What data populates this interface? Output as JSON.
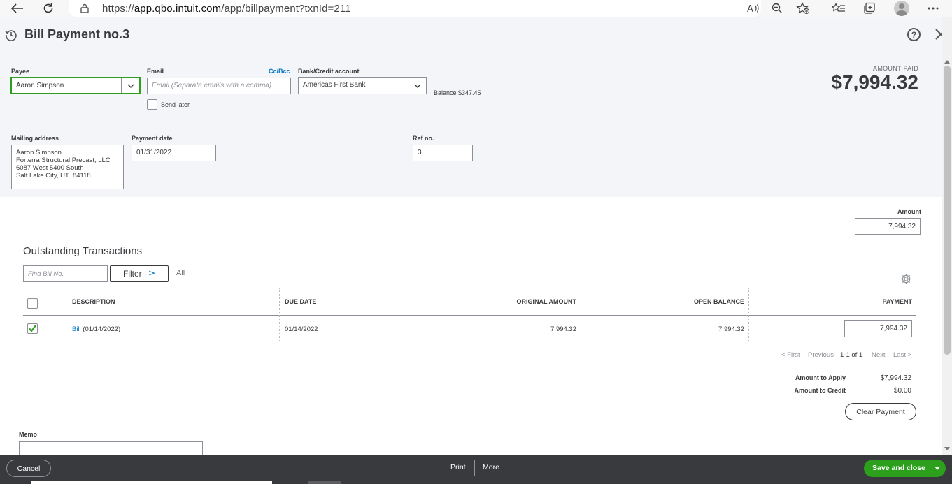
{
  "browser": {
    "url_prefix": "https://",
    "url_host": "app.qbo.intuit.com",
    "url_path": "/app/billpayment?txnId=211"
  },
  "header": {
    "title": "Bill Payment no.3",
    "help_glyph": "?",
    "payee_label": "Payee",
    "payee_value": "Aaron Simpson",
    "email_label": "Email",
    "email_placeholder": "Email (Separate emails with a comma)",
    "cc_bcc": "Cc/Bcc",
    "send_later": "Send later",
    "bank_label": "Bank/Credit account",
    "bank_value": "Americas First Bank",
    "balance": "Balance $347.45",
    "amount_paid_label": "AMOUNT PAID",
    "amount_paid": "$7,994.32",
    "mailing_label": "Mailing address",
    "mailing_address": "Aaron Simpson\nForterra Structural Precast, LLC\n6087 West 5400 South\nSalt Lake City, UT  84118",
    "payment_date_label": "Payment date",
    "payment_date": "01/31/2022",
    "ref_label": "Ref no.",
    "ref_value": "3"
  },
  "body": {
    "amount_label": "Amount",
    "amount_value": "7,994.32",
    "section_title": "Outstanding Transactions",
    "find_placeholder": "Find Bill No.",
    "filter_label": "Filter",
    "filter_chevron": ">",
    "all_label": "All"
  },
  "table": {
    "columns": [
      "DESCRIPTION",
      "DUE DATE",
      "ORIGINAL AMOUNT",
      "OPEN BALANCE",
      "PAYMENT"
    ],
    "rows": [
      {
        "checked": true,
        "description_link": "Bill",
        "description_rest": " (01/14/2022)",
        "due_date": "01/14/2022",
        "original_amount": "7,994.32",
        "open_balance": "7,994.32",
        "payment": "7,994.32"
      }
    ]
  },
  "pager": {
    "first": "< First",
    "previous": "Previous",
    "range": "1-1 of 1",
    "next": "Next",
    "last": "Last >"
  },
  "summary": {
    "apply_label": "Amount to Apply",
    "apply_value": "$7,994.32",
    "credit_label": "Amount to Credit",
    "credit_value": "$0.00",
    "clear_button": "Clear Payment",
    "memo_label": "Memo"
  },
  "footer": {
    "cancel": "Cancel",
    "print": "Print",
    "more": "More",
    "save_close": "Save and close"
  },
  "colors": {
    "accent_green": "#2ca01c",
    "link_blue": "#0077c5",
    "footer_bg": "#393a3d",
    "header_bg": "#f4f5f8"
  },
  "icons": [
    "back-arrow-icon",
    "refresh-icon",
    "lock-icon",
    "read-aloud-icon",
    "zoom-out-icon",
    "add-favorite-icon",
    "favorites-icon",
    "collections-icon",
    "profile-avatar",
    "more-icon",
    "history-icon",
    "help-icon",
    "close-icon",
    "chevron-down-icon",
    "gear-icon",
    "checkmark-icon"
  ]
}
